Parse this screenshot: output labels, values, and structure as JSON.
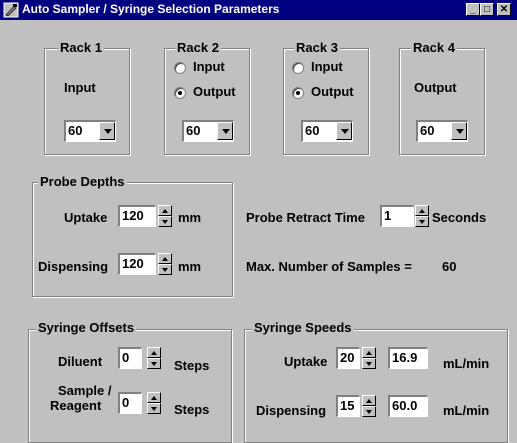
{
  "window": {
    "title": "Auto Sampler / Syringe Selection Parameters",
    "minimize": "_",
    "restore": "□",
    "close": "✕"
  },
  "racks": [
    {
      "label": "Rack 1",
      "mode": "Input",
      "value": "60"
    },
    {
      "label": "Rack 2",
      "option_input": "Input",
      "option_output": "Output",
      "selected": "Output",
      "value": "60"
    },
    {
      "label": "Rack 3",
      "option_input": "Input",
      "option_output": "Output",
      "selected": "Output",
      "value": "60"
    },
    {
      "label": "Rack 4",
      "mode": "Output",
      "value": "60"
    }
  ],
  "probe_depths": {
    "legend": "Probe Depths",
    "uptake_label": "Uptake",
    "uptake_value": "120",
    "dispensing_label": "Dispensing",
    "dispensing_value": "120",
    "unit": "mm"
  },
  "probe_retract": {
    "label": "Probe Retract Time",
    "value": "1",
    "unit": "Seconds"
  },
  "max_samples": {
    "label": "Max. Number of Samples =",
    "value": "60"
  },
  "syringe_offsets": {
    "legend": "Syringe Offsets",
    "diluent_label": "Diluent",
    "diluent_value": "0",
    "sample_label_line1": "Sample /",
    "sample_label_line2": "Reagent",
    "sample_value": "0",
    "unit": "Steps"
  },
  "syringe_speeds": {
    "legend": "Syringe Speeds",
    "uptake_label": "Uptake",
    "uptake_setting": "20",
    "uptake_rate": "16.9",
    "dispensing_label": "Dispensing",
    "dispensing_setting": "15",
    "dispensing_rate": "60.0",
    "unit": "mL/min"
  }
}
